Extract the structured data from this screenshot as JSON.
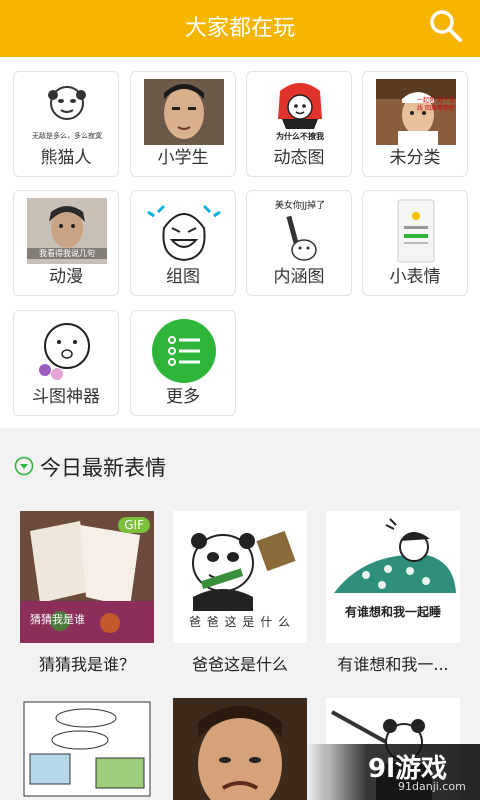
{
  "header": {
    "title": "大家都在玩",
    "search_icon": "search-icon"
  },
  "categories": [
    {
      "label": "熊猫人",
      "thumb_text": "无敌是多么，多么寂寞"
    },
    {
      "label": "小学生",
      "thumb_text": ""
    },
    {
      "label": "动态图",
      "thumb_text": "为什么不撩我"
    },
    {
      "label": "未分类",
      "thumb_text": "一起死 泡个毛线 回家等死吧"
    },
    {
      "label": "动漫",
      "thumb_text": "我看得我说几句"
    },
    {
      "label": "组图",
      "thumb_text": ""
    },
    {
      "label": "内涵图",
      "thumb_text": "美女你JJ掉了"
    },
    {
      "label": "小表情",
      "thumb_text": ""
    },
    {
      "label": "斗图神器",
      "thumb_text": ""
    },
    {
      "label": "更多",
      "thumb_text": ""
    }
  ],
  "section": {
    "title": "今日最新表情",
    "icon": "chevron-down-circle-icon"
  },
  "cards": [
    {
      "caption": "猜猜我是谁？",
      "badge": "GIF",
      "img_text": "猜猜我是谁"
    },
    {
      "caption": "爸爸这是什么",
      "badge": "",
      "img_text": "爸 爸 这 是 什 么"
    },
    {
      "caption": "有谁想和我一...",
      "badge": "",
      "img_text": "有谁想和我一起睡"
    }
  ],
  "watermark": {
    "main": "9l游戏",
    "sub": "91danji.com"
  },
  "colors": {
    "header_bg": "#f6b500",
    "accent_green": "#2fb53a"
  }
}
